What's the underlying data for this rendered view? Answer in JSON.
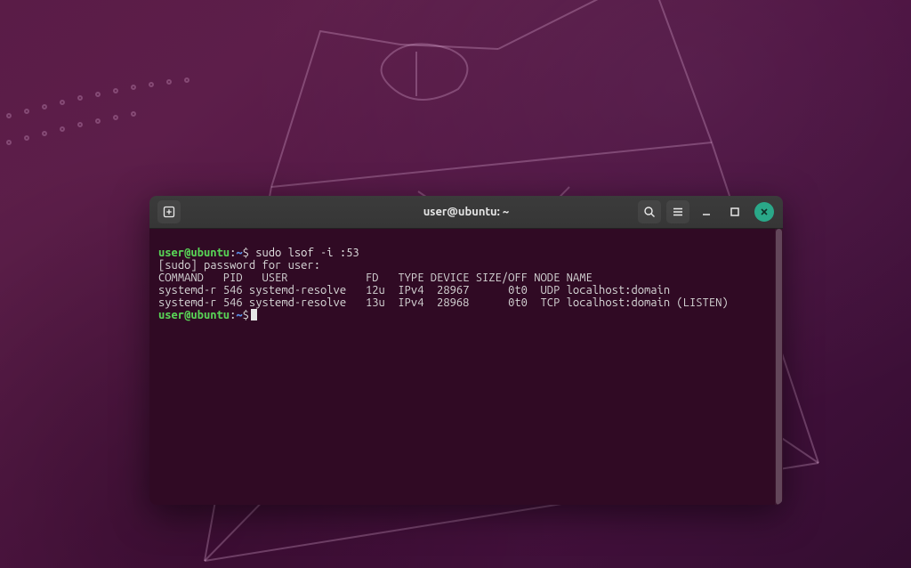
{
  "window": {
    "title": "user@ubuntu: ~"
  },
  "prompt": {
    "user_host": "user@ubuntu",
    "separator": ":",
    "path": "~",
    "symbol": "$"
  },
  "commands": {
    "first": "sudo lsof -i :53"
  },
  "output": {
    "sudo_prompt": "[sudo] password for user:",
    "header": "COMMAND   PID   USER            FD   TYPE DEVICE SIZE/OFF NODE NAME",
    "row1": "systemd-r 546 systemd-resolve   12u  IPv4  28967      0t0  UDP localhost:domain",
    "row2": "systemd-r 546 systemd-resolve   13u  IPv4  28968      0t0  TCP localhost:domain (LISTEN)"
  },
  "icons": {
    "new_tab": "new-tab-icon",
    "search": "search-icon",
    "menu": "hamburger-icon",
    "minimize": "minimize-icon",
    "maximize": "maximize-icon",
    "close": "close-icon"
  },
  "colors": {
    "terminal_bg": "#300a24",
    "user_host": "#58d356",
    "path": "#5a8fe8",
    "titlebar": "#373737",
    "close": "#2aa889"
  }
}
